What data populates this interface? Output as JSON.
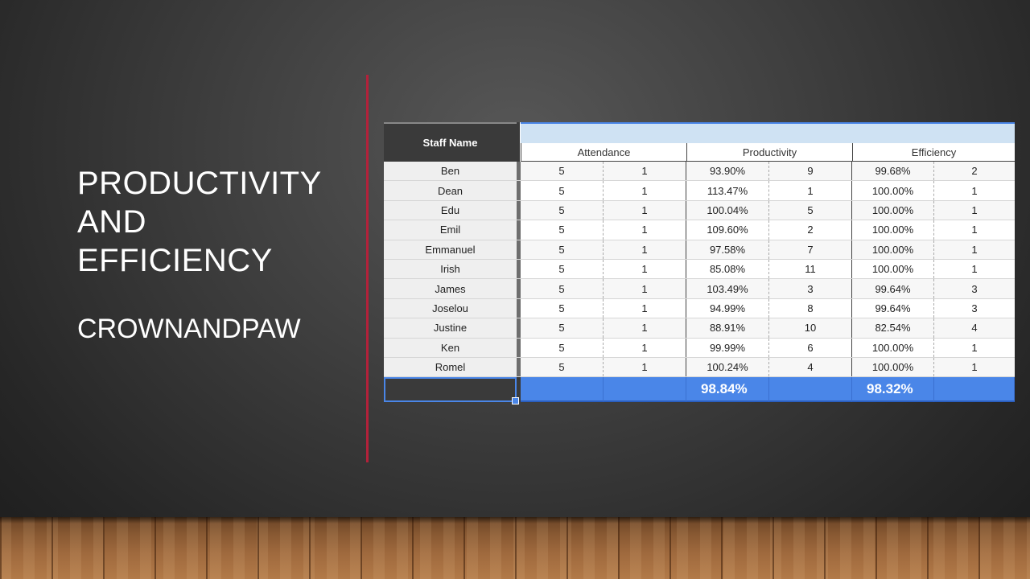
{
  "slide": {
    "title_lines": [
      "PRODUCTIVITY",
      "AND",
      "EFFICIENCY"
    ],
    "subtitle": "CROWNANDPAW",
    "accent_color": "#b3213a"
  },
  "table": {
    "name_header": "Staff Name",
    "groups": [
      "Attendance",
      "Productivity",
      "Efficiency"
    ],
    "rows": [
      {
        "name": "Ben",
        "att": "5",
        "att_rank": "1",
        "prod": "93.90%",
        "prod_rank": "9",
        "eff": "99.68%",
        "eff_rank": "2"
      },
      {
        "name": "Dean",
        "att": "5",
        "att_rank": "1",
        "prod": "113.47%",
        "prod_rank": "1",
        "eff": "100.00%",
        "eff_rank": "1"
      },
      {
        "name": "Edu",
        "att": "5",
        "att_rank": "1",
        "prod": "100.04%",
        "prod_rank": "5",
        "eff": "100.00%",
        "eff_rank": "1"
      },
      {
        "name": "Emil",
        "att": "5",
        "att_rank": "1",
        "prod": "109.60%",
        "prod_rank": "2",
        "eff": "100.00%",
        "eff_rank": "1"
      },
      {
        "name": "Emmanuel",
        "att": "5",
        "att_rank": "1",
        "prod": "97.58%",
        "prod_rank": "7",
        "eff": "100.00%",
        "eff_rank": "1"
      },
      {
        "name": "Irish",
        "att": "5",
        "att_rank": "1",
        "prod": "85.08%",
        "prod_rank": "11",
        "eff": "100.00%",
        "eff_rank": "1"
      },
      {
        "name": "James",
        "att": "5",
        "att_rank": "1",
        "prod": "103.49%",
        "prod_rank": "3",
        "eff": "99.64%",
        "eff_rank": "3"
      },
      {
        "name": "Joselou",
        "att": "5",
        "att_rank": "1",
        "prod": "94.99%",
        "prod_rank": "8",
        "eff": "99.64%",
        "eff_rank": "3"
      },
      {
        "name": "Justine",
        "att": "5",
        "att_rank": "1",
        "prod": "88.91%",
        "prod_rank": "10",
        "eff": "82.54%",
        "eff_rank": "4"
      },
      {
        "name": "Ken",
        "att": "5",
        "att_rank": "1",
        "prod": "99.99%",
        "prod_rank": "6",
        "eff": "100.00%",
        "eff_rank": "1"
      },
      {
        "name": "Romel",
        "att": "5",
        "att_rank": "1",
        "prod": "100.24%",
        "prod_rank": "4",
        "eff": "100.00%",
        "eff_rank": "1"
      }
    ],
    "totals": {
      "productivity": "98.84%",
      "efficiency": "98.32%"
    },
    "header_band_color": "#cfe2f3",
    "total_row_color": "#4a86e8"
  }
}
